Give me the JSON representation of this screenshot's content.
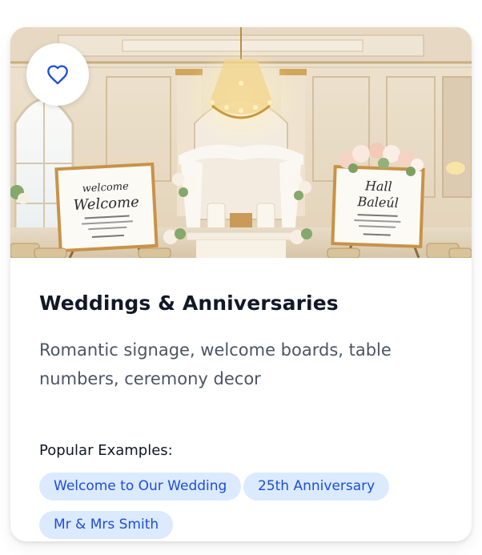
{
  "card": {
    "title": "Weddings & Anniversaries",
    "description": "Romantic signage, welcome boards, table numbers, ceremony decor",
    "examples_label": "Popular Examples:",
    "examples": [
      "Welcome to Our Wedding",
      "25th Anniversary",
      "Mr & Mrs Smith"
    ],
    "favorite_icon": "heart-icon",
    "image_alt": "wedding-venue-photo"
  },
  "colors": {
    "accent": "#1d4ed8",
    "tag_bg": "#dbeafe",
    "title": "#111827",
    "text": "#4b5563"
  }
}
